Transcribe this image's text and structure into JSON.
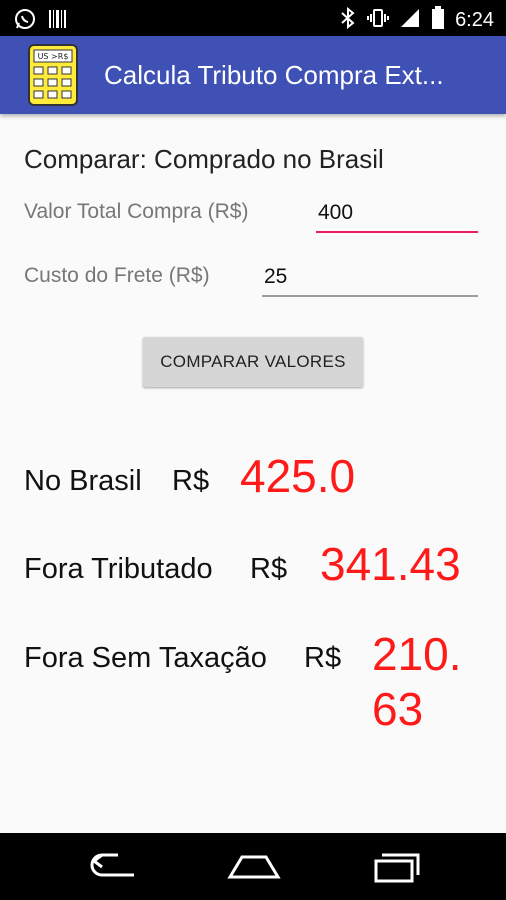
{
  "status_bar": {
    "time": "6:24"
  },
  "app_bar": {
    "title": "Calcula Tributo Compra Ext...",
    "icon_text": "US >R$"
  },
  "form": {
    "heading": "Comparar: Comprado no Brasil",
    "valor_label": "Valor Total Compra (R$)",
    "valor_value": "400",
    "frete_label": "Custo do Frete (R$)",
    "frete_value": "25",
    "button_label": "COMPARAR VALORES"
  },
  "results": {
    "brasil_label": "No Brasil",
    "brasil_currency": "R$",
    "brasil_value": "425.0",
    "tributado_label": "Fora Tributado",
    "tributado_currency": "R$",
    "tributado_value": "341.43",
    "sem_taxacao_label": "Fora Sem Taxação",
    "sem_taxacao_currency": "R$",
    "sem_taxacao_value_line1": "210.",
    "sem_taxacao_value_line2": "63"
  },
  "colors": {
    "app_bar": "#3f51b5",
    "accent_line": "#e91e63",
    "result_value": "#ff1a1a"
  },
  "icons": [
    "whatsapp-icon",
    "barcode-icon",
    "bluetooth-icon",
    "vibrate-icon",
    "signal-icon",
    "battery-icon",
    "back-icon",
    "home-icon",
    "recents-icon"
  ]
}
